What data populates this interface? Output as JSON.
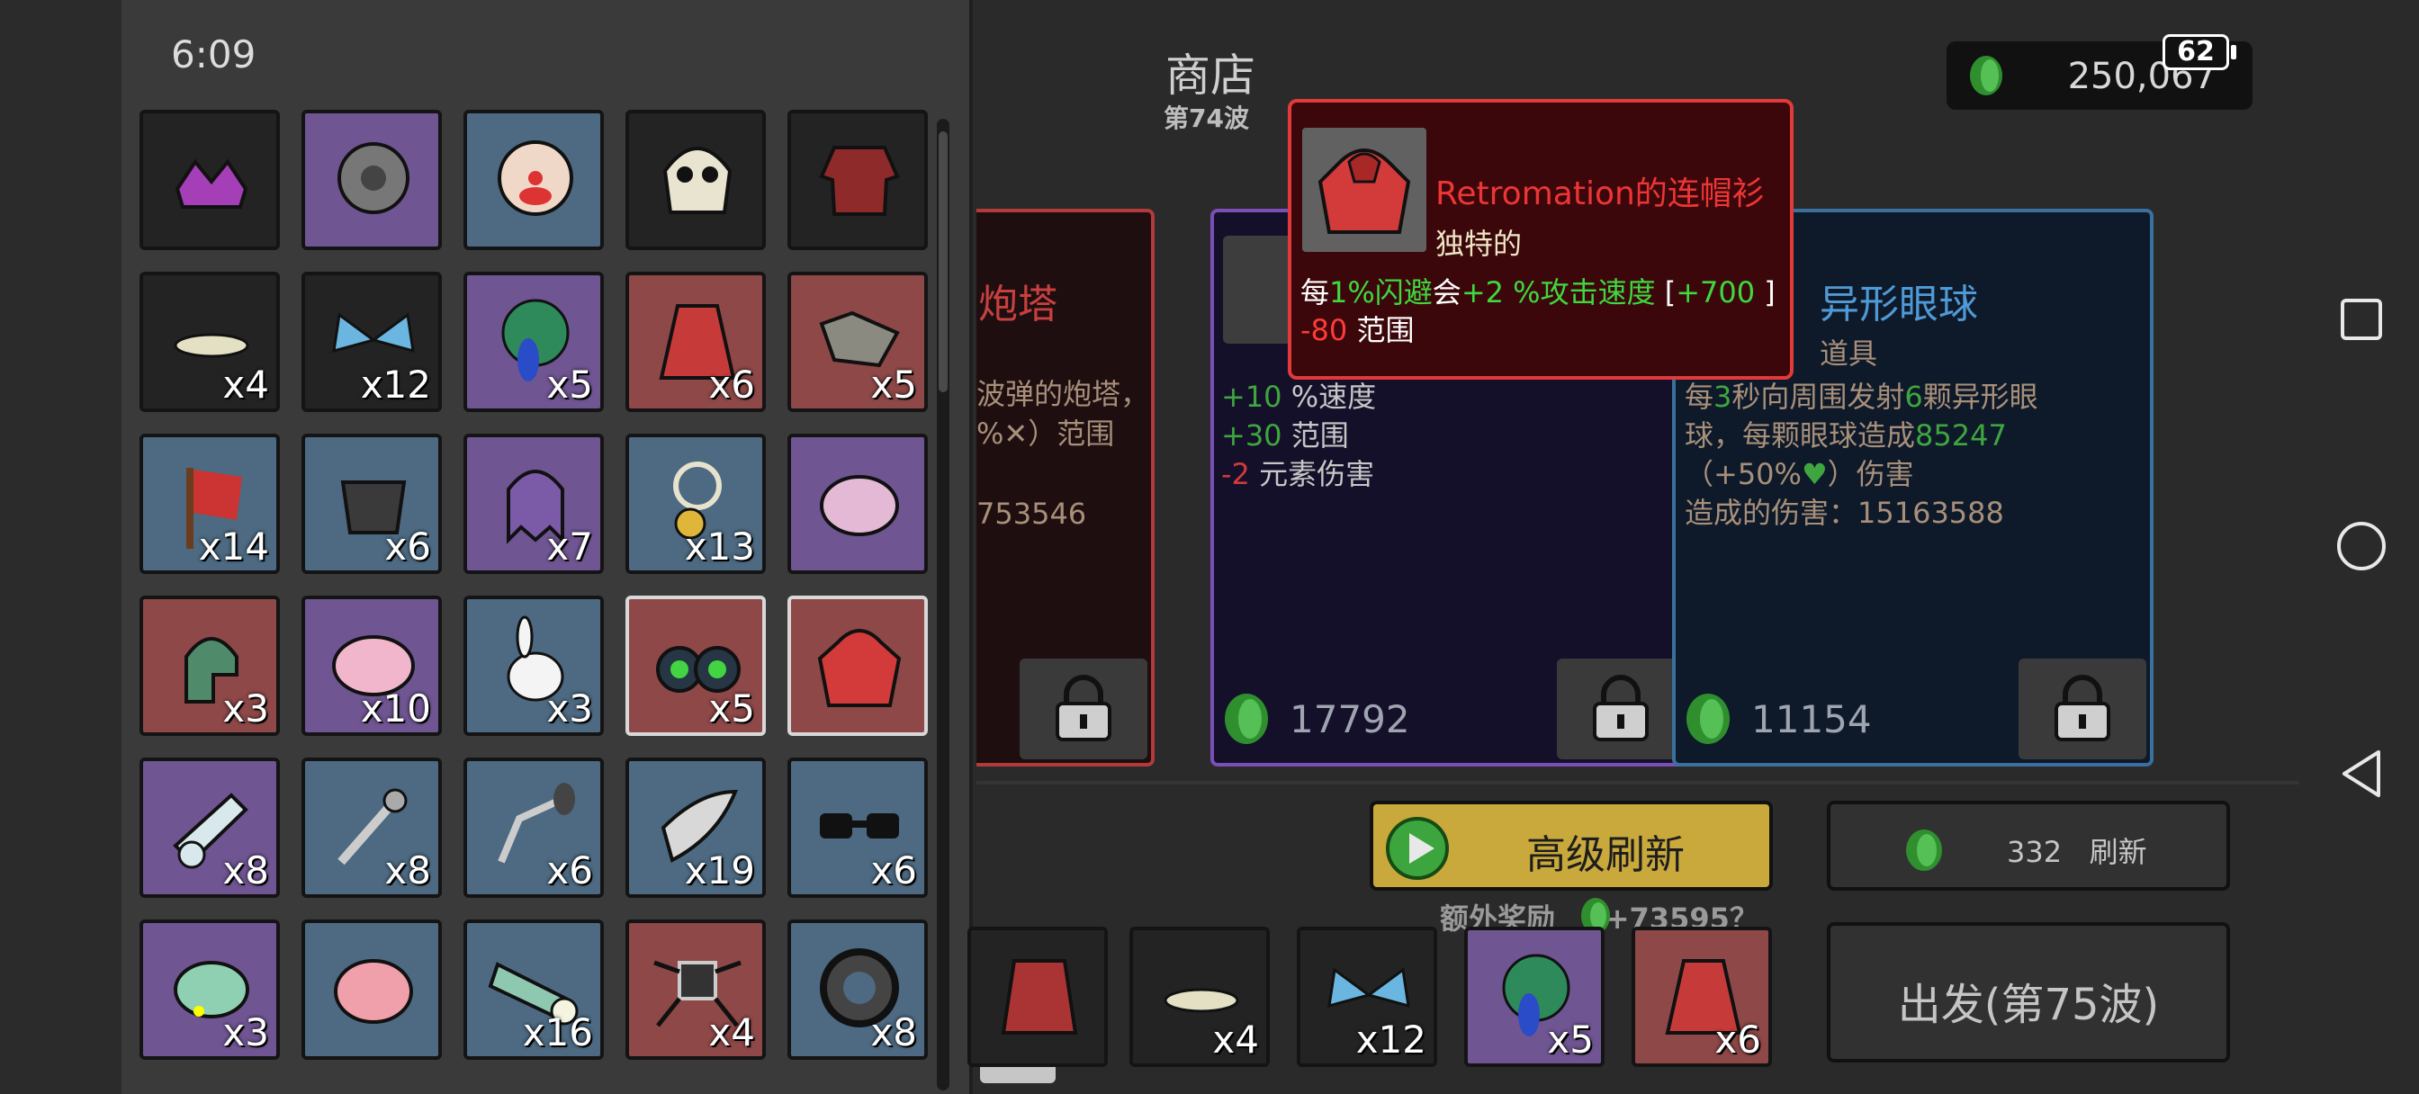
{
  "status": {
    "time": "6:09",
    "battery": "62"
  },
  "inventory": {
    "items": [
      {
        "name": "purple-crown-item",
        "bg": "black",
        "qty": ""
      },
      {
        "name": "spiked-wheel-item",
        "bg": "purple",
        "qty": ""
      },
      {
        "name": "clown-mask-item",
        "bg": "blue",
        "qty": ""
      },
      {
        "name": "skull-item",
        "bg": "black",
        "qty": ""
      },
      {
        "name": "plaid-shirt-item",
        "bg": "black",
        "qty": ""
      },
      {
        "name": "lizard-item",
        "bg": "black",
        "qty": "x4"
      },
      {
        "name": "butterfly-item",
        "bg": "black",
        "qty": "x12"
      },
      {
        "name": "peacock-item",
        "bg": "purple",
        "qty": "x5"
      },
      {
        "name": "red-cape-item",
        "bg": "red",
        "qty": "x6"
      },
      {
        "name": "wolf-head-item",
        "bg": "red",
        "qty": "x5"
      },
      {
        "name": "red-flag-item",
        "bg": "blue",
        "qty": "x14"
      },
      {
        "name": "metal-bucket-item",
        "bg": "blue",
        "qty": "x6"
      },
      {
        "name": "purple-ghost-item",
        "bg": "purple",
        "qty": "x7"
      },
      {
        "name": "gold-pendant-item",
        "bg": "blue",
        "qty": "x13"
      },
      {
        "name": "brain-item",
        "bg": "purple",
        "qty": ""
      },
      {
        "name": "green-tentacle-item",
        "bg": "red",
        "qty": "x3"
      },
      {
        "name": "pink-blob-item",
        "bg": "purple",
        "qty": "x10"
      },
      {
        "name": "white-rabbit-item",
        "bg": "blue",
        "qty": "x3"
      },
      {
        "name": "binoculars-item",
        "bg": "red",
        "qty": "x5",
        "selected": true
      },
      {
        "name": "red-hoodie-item",
        "bg": "red",
        "qty": "",
        "selected": true
      },
      {
        "name": "cannon-item",
        "bg": "purple",
        "qty": "x8"
      },
      {
        "name": "claw-tool-item",
        "bg": "blue",
        "qty": "x8"
      },
      {
        "name": "grabber-arm-item",
        "bg": "blue",
        "qty": "x6"
      },
      {
        "name": "crescent-blade-item",
        "bg": "blue",
        "qty": "x19"
      },
      {
        "name": "sunglasses-item",
        "bg": "blue",
        "qty": "x6"
      },
      {
        "name": "chameleon-item",
        "bg": "purple",
        "qty": "x3"
      },
      {
        "name": "piggy-bank-item",
        "bg": "blue",
        "qty": ""
      },
      {
        "name": "flashlight-item",
        "bg": "blue",
        "qty": "x16"
      },
      {
        "name": "robot-spider-item",
        "bg": "red",
        "qty": "x4"
      },
      {
        "name": "gear-ring-item",
        "bg": "blue",
        "qty": "x8"
      }
    ]
  },
  "shop": {
    "title": "商店",
    "wave": "第74波",
    "money": "250,067",
    "cards": [
      {
        "title": "炮塔",
        "desc_line1": "波弹的炮塔，",
        "desc_line2": "%✕）范围",
        "dmg": "753546"
      },
      {
        "stats": [
          {
            "value": "+10",
            "label": " %速度",
            "sign": "plus"
          },
          {
            "value": "+30",
            "label": " 范围",
            "sign": "plus"
          },
          {
            "value": "-2",
            "label": " 元素伤害",
            "sign": "minus"
          }
        ],
        "price": "17792"
      },
      {
        "title": "异形眼球",
        "subtitle": "道具",
        "desc_a": "每",
        "desc_b": "3",
        "desc_c": "秒向周围发射",
        "desc_d": "6",
        "desc_e": "颗异形眼球，每颗眼球造成",
        "desc_f": "85247",
        "desc_g": "（+50%",
        "desc_h": "♥",
        "desc_i": "）伤害",
        "dmg": "造成的伤害：15163588",
        "price": "11154"
      }
    ],
    "tooltip": {
      "name": "Retromation的连帽衫",
      "rarity": "独特的",
      "l1_a": "每",
      "l1_b": "1%闪避",
      "l1_c": "会",
      "l1_d": "+2 %攻击速度",
      "l1_e": " [",
      "l1_f": "+700",
      "l1_g": " ]",
      "l2_a": "-80",
      "l2_b": " 范围"
    },
    "advanced_refresh": "高级刷新",
    "refresh_cost": "332",
    "refresh_label": "刷新",
    "bonus": "额外奖励",
    "bonus_value": "+73595？",
    "go_button": "出发(第75波)"
  },
  "tray": [
    {
      "name": "tray-red-item",
      "bg": "black",
      "qty": ""
    },
    {
      "name": "tray-lizard-item",
      "bg": "black",
      "qty": "x4"
    },
    {
      "name": "tray-butterfly-item",
      "bg": "black",
      "qty": "x12"
    },
    {
      "name": "tray-peacock-item",
      "bg": "purple",
      "qty": "x5"
    },
    {
      "name": "tray-red-cape-item",
      "bg": "red",
      "qty": "x6"
    }
  ],
  "colors": {
    "green_stat": "#3fd83f",
    "red_stat": "#ff3a3a",
    "tooltip_border": "#e23a3a",
    "gold_button": "#c9a93c"
  }
}
